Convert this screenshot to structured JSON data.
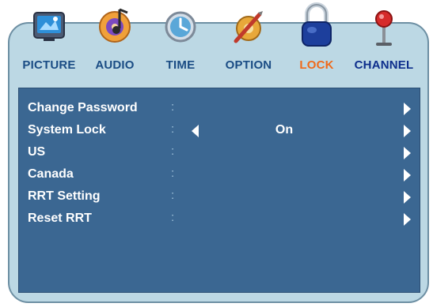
{
  "tabs": [
    {
      "label": "PICTURE",
      "icon": "picture-icon"
    },
    {
      "label": "AUDIO",
      "icon": "audio-icon"
    },
    {
      "label": "TIME",
      "icon": "clock-icon"
    },
    {
      "label": "OPTION",
      "icon": "option-icon"
    },
    {
      "label": "LOCK",
      "icon": "padlock-icon",
      "active": true
    },
    {
      "label": "CHANNEL",
      "icon": "antenna-icon"
    }
  ],
  "colors": {
    "active_tab": "#f06a1a",
    "tab_label": "#1a4c84",
    "panel_bg": "#3b6792",
    "frame_bg": "#bcd8e4"
  },
  "menu": {
    "colon": ":",
    "items": [
      {
        "label": "Change Password",
        "value": ""
      },
      {
        "label": "System Lock",
        "value": "On"
      },
      {
        "label": "US",
        "value": ""
      },
      {
        "label": "Canada",
        "value": ""
      },
      {
        "label": "RRT Setting",
        "value": ""
      },
      {
        "label": "Reset RRT",
        "value": ""
      }
    ]
  }
}
